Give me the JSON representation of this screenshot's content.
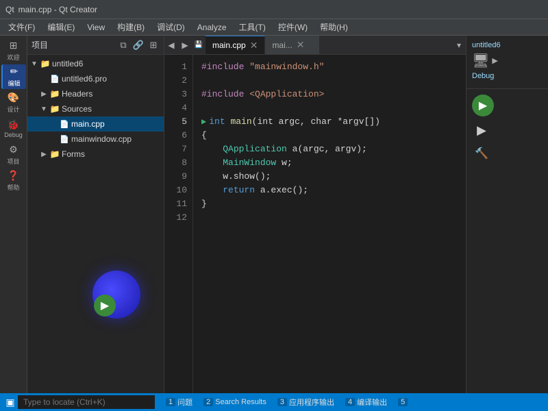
{
  "titlebar": {
    "logo": "Qt",
    "title": "main.cpp - Qt Creator"
  },
  "menubar": {
    "items": [
      "文件(F)",
      "编辑(E)",
      "View",
      "构建(B)",
      "调试(D)",
      "Analyze",
      "工具(T)",
      "控件(W)",
      "帮助(H)"
    ]
  },
  "project_panel": {
    "toolbar_title": "项目",
    "tree": [
      {
        "level": 0,
        "arrow": "▼",
        "icon": "📁",
        "label": "untitled6",
        "type": "folder"
      },
      {
        "level": 1,
        "arrow": "",
        "icon": "📄",
        "label": "untitled6.pro",
        "type": "file"
      },
      {
        "level": 1,
        "arrow": "▶",
        "icon": "📁",
        "label": "Headers",
        "type": "folder"
      },
      {
        "level": 1,
        "arrow": "▼",
        "icon": "📁",
        "label": "Sources",
        "type": "folder",
        "expanded": true
      },
      {
        "level": 2,
        "arrow": "",
        "icon": "📄",
        "label": "main.cpp",
        "type": "file",
        "selected": true
      },
      {
        "level": 2,
        "arrow": "",
        "icon": "📄",
        "label": "mainwindow.cpp",
        "type": "file"
      },
      {
        "level": 1,
        "arrow": "▶",
        "icon": "📁",
        "label": "Forms",
        "type": "folder"
      }
    ]
  },
  "editor": {
    "tabs": [
      {
        "label": "main.cpp",
        "active": true
      },
      {
        "label": "mai...",
        "active": false
      }
    ],
    "lines": [
      {
        "num": 1,
        "content": [
          {
            "t": "inc",
            "v": "#include "
          },
          {
            "t": "str",
            "v": "\"mainwindow.h\""
          }
        ]
      },
      {
        "num": 2,
        "content": []
      },
      {
        "num": 3,
        "content": [
          {
            "t": "inc",
            "v": "#include "
          },
          {
            "t": "str",
            "v": "<QApplication>"
          }
        ]
      },
      {
        "num": 4,
        "content": []
      },
      {
        "num": 5,
        "content": [
          {
            "t": "kw",
            "v": "int"
          },
          {
            "t": "punc",
            "v": " "
          },
          {
            "t": "fn",
            "v": "main"
          },
          {
            "t": "punc",
            "v": "(int argc, char *argv[])"
          }
        ]
      },
      {
        "num": 6,
        "content": [
          {
            "t": "punc",
            "v": "{"
          }
        ]
      },
      {
        "num": 7,
        "content": [
          {
            "t": "punc",
            "v": "    "
          },
          {
            "t": "type",
            "v": "QApplication"
          },
          {
            "t": "punc",
            "v": " a(argc, argv);"
          }
        ]
      },
      {
        "num": 8,
        "content": [
          {
            "t": "punc",
            "v": "    "
          },
          {
            "t": "type",
            "v": "MainWindow"
          },
          {
            "t": "punc",
            "v": " w;"
          }
        ]
      },
      {
        "num": 9,
        "content": [
          {
            "t": "punc",
            "v": "    w.show();"
          }
        ]
      },
      {
        "num": 10,
        "content": [
          {
            "t": "punc",
            "v": "    "
          },
          {
            "t": "kw",
            "v": "return"
          },
          {
            "t": "punc",
            "v": " a.exec();"
          }
        ]
      },
      {
        "num": 11,
        "content": [
          {
            "t": "punc",
            "v": "}"
          }
        ]
      },
      {
        "num": 12,
        "content": []
      }
    ]
  },
  "left_sidebar": {
    "items": [
      {
        "icon": "⊞",
        "label": "欢迎",
        "active": false
      },
      {
        "icon": "✏",
        "label": "编辑",
        "active": true
      },
      {
        "icon": "🎨",
        "label": "设计",
        "active": false
      },
      {
        "icon": "🐞",
        "label": "Debug",
        "active": false
      },
      {
        "icon": "⚙",
        "label": "项目",
        "active": false
      },
      {
        "icon": "❓",
        "label": "帮助",
        "active": false
      }
    ]
  },
  "right_panel": {
    "project_name": "untitled6",
    "debug_label": "Debug"
  },
  "bottom_bar": {
    "locate_placeholder": "Type to locate (Ctrl+K)",
    "status_items": [
      {
        "num": "1",
        "label": "问题"
      },
      {
        "num": "2",
        "label": "Search Results"
      },
      {
        "num": "3",
        "label": "应用程序输出"
      },
      {
        "num": "4",
        "label": "编译输出"
      },
      {
        "num": "5",
        "label": ""
      }
    ]
  }
}
